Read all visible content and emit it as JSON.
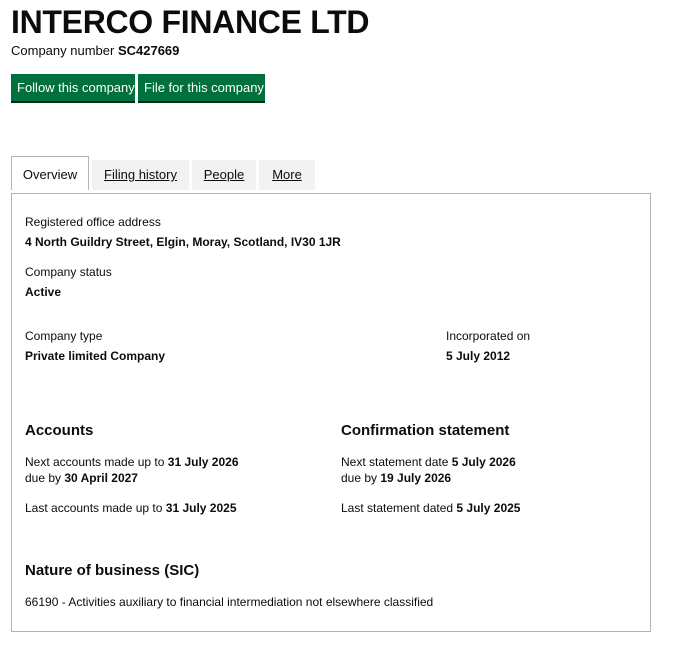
{
  "company": {
    "name": "INTERCO FINANCE LTD",
    "number_label": "Company number",
    "number": "SC427669"
  },
  "actions": {
    "follow": "Follow this company",
    "file": "File for this company"
  },
  "tabs": [
    {
      "label": "Overview",
      "active": true
    },
    {
      "label": "Filing history",
      "active": false
    },
    {
      "label": "People",
      "active": false
    },
    {
      "label": "More",
      "active": false
    }
  ],
  "overview": {
    "address_label": "Registered office address",
    "address": "4 North Guildry Street, Elgin, Moray, Scotland, IV30 1JR",
    "status_label": "Company status",
    "status": "Active",
    "type_label": "Company type",
    "type": "Private limited Company",
    "incorporated_label": "Incorporated on",
    "incorporated": "5 July 2012"
  },
  "accounts": {
    "heading": "Accounts",
    "next_prefix": "Next accounts made up to",
    "next_date": "31 July 2026",
    "due_prefix": "due by",
    "due_date": "30 April 2027",
    "last_prefix": "Last accounts made up to",
    "last_date": "31 July 2025"
  },
  "confirmation": {
    "heading": "Confirmation statement",
    "next_prefix": "Next statement date",
    "next_date": "5 July 2026",
    "due_prefix": "due by",
    "due_date": "19 July 2026",
    "last_prefix": "Last statement dated",
    "last_date": "5 July 2025"
  },
  "sic": {
    "heading": "Nature of business (SIC)",
    "item": "66190 - Activities auxiliary to financial intermediation not elsewhere classified"
  },
  "colors": {
    "button_green": "#00703c",
    "tab_inactive_bg": "#f3f2f1",
    "border": "#b1b4b6"
  }
}
